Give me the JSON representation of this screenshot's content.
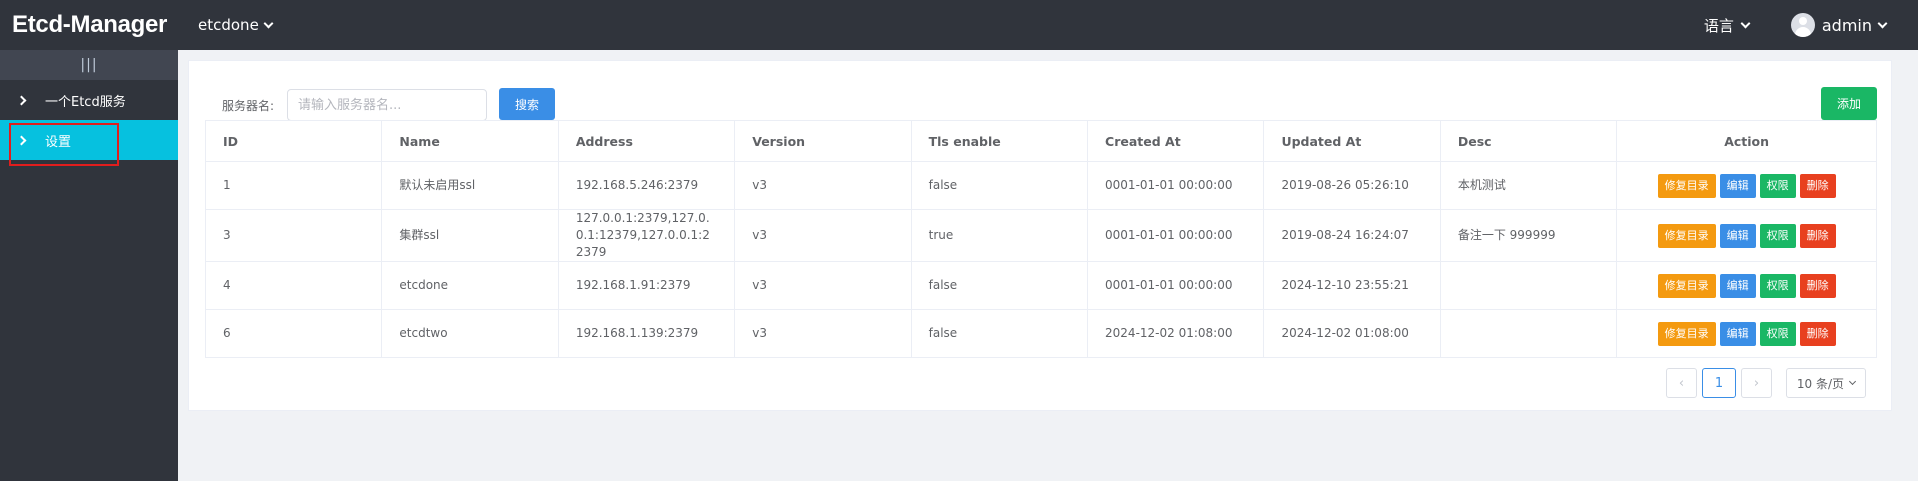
{
  "header": {
    "brand": "Etcd-Manager",
    "server_selected": "etcdone",
    "language_label": "语言",
    "user_name": "admin"
  },
  "sidebar": {
    "collapse_icon": "|||",
    "items": [
      {
        "label": "一个Etcd服务",
        "active": false
      },
      {
        "label": "设置",
        "active": true
      }
    ]
  },
  "search": {
    "label": "服务器名:",
    "placeholder": "请输入服务器名...",
    "button": "搜索"
  },
  "add_button": "添加",
  "table": {
    "columns": [
      "ID",
      "Name",
      "Address",
      "Version",
      "Tls enable",
      "Created At",
      "Updated At",
      "Desc",
      "Action"
    ],
    "rows": [
      {
        "id": "1",
        "name": "默认未启用ssl",
        "address": "192.168.5.246:2379",
        "version": "v3",
        "tls": "false",
        "created": "0001-01-01 00:00:00",
        "updated": "2019-08-26 05:26:10",
        "desc": "本机测试"
      },
      {
        "id": "3",
        "name": "集群ssl",
        "address": "127.0.0.1:2379,127.0.0.1:12379,127.0.0.1:22379",
        "version": "v3",
        "tls": "true",
        "created": "0001-01-01 00:00:00",
        "updated": "2019-08-24 16:24:07",
        "desc": "备注一下 999999"
      },
      {
        "id": "4",
        "name": "etcdone",
        "address": "192.168.1.91:2379",
        "version": "v3",
        "tls": "false",
        "created": "0001-01-01 00:00:00",
        "updated": "2024-12-10 23:55:21",
        "desc": ""
      },
      {
        "id": "6",
        "name": "etcdtwo",
        "address": "192.168.1.139:2379",
        "version": "v3",
        "tls": "false",
        "created": "2024-12-02 01:08:00",
        "updated": "2024-12-02 01:08:00",
        "desc": ""
      }
    ],
    "actions": {
      "dir": "修复目录",
      "edit": "编辑",
      "perm": "权限",
      "del": "删除"
    }
  },
  "pagination": {
    "prev": "‹",
    "current": "1",
    "next": "›",
    "page_size": "10 条/页"
  },
  "colors": {
    "topbar": "#30343c",
    "active_menu": "#06c1df",
    "primary": "#3a8ee6",
    "success": "#1ab765",
    "warning": "#f49a10",
    "danger": "#e8401f"
  }
}
